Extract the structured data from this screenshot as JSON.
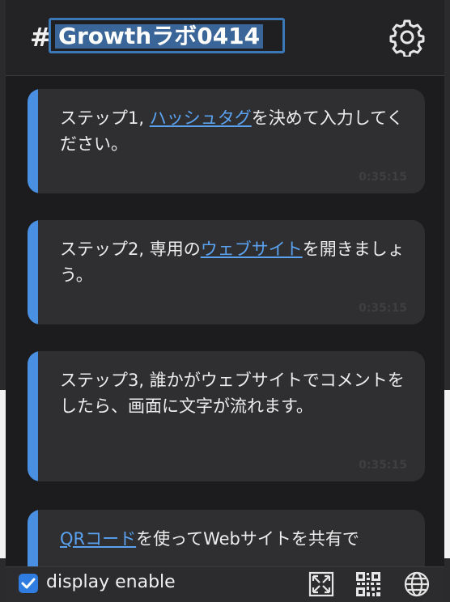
{
  "header": {
    "hash_symbol": "#",
    "hashtag_value": "Growthラボ0414",
    "settings_icon": "gear-icon"
  },
  "messages": [
    {
      "prefix": "ステップ1, ",
      "link": "ハッシュタグ",
      "suffix": "を決めて入力してください。",
      "time": "0:35:15"
    },
    {
      "prefix": "ステップ2, 専用の",
      "link": "ウェブサイト",
      "suffix": "を開きましょう。",
      "time": "0:35:15"
    },
    {
      "prefix": "ステップ3, 誰かがウェブサイトでコメントをしたら、画面に文字が流れます。",
      "link": "",
      "suffix": "",
      "time": "0:35:15"
    },
    {
      "prefix": "",
      "link": "QRコード",
      "suffix": "を使ってWebサイトを共有で",
      "time": ""
    }
  ],
  "footer": {
    "checkbox_checked": true,
    "checkbox_label": "display enable",
    "icons": [
      "fullscreen-icon",
      "qr-code-icon",
      "globe-icon"
    ]
  },
  "colors": {
    "accent": "#4a90e2",
    "link": "#5aa2f0",
    "card_bg": "#2f2f31"
  }
}
